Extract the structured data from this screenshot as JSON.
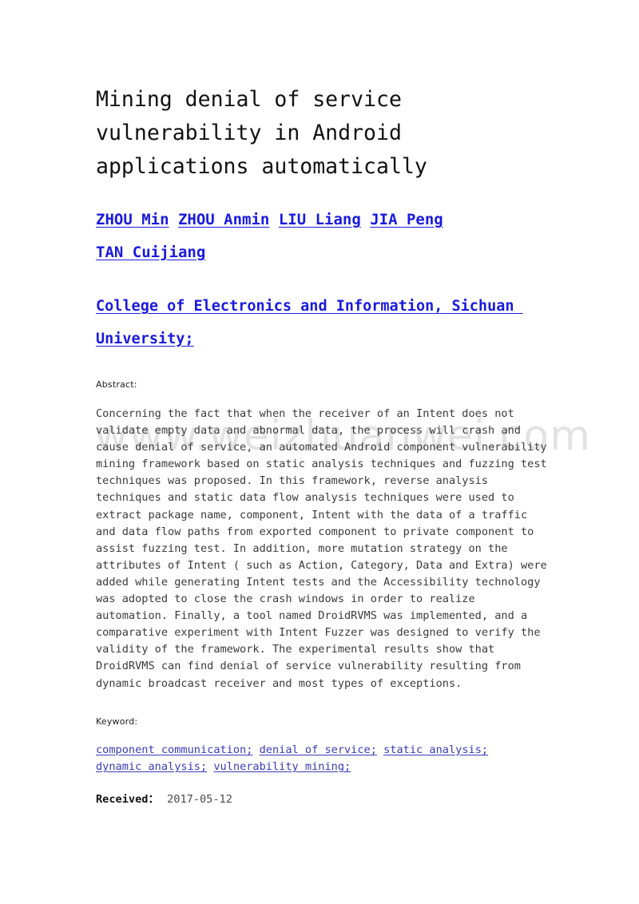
{
  "document": {
    "title": "Mining denial of service vulnerability in Android applications automatically",
    "authors": [
      "ZHOU Min",
      "ZHOU Anmin",
      "LIU Liang",
      "JIA Peng",
      "TAN Cuijiang"
    ],
    "affiliation": "College of Electronics and Information, Sichuan University;",
    "abstract_label": "Abstract:",
    "abstract_text": "Concerning the fact that when the receiver of an Intent does not validate empty data and abnormal data, the process will crash and cause denial of service, an automated Android component vulnerability mining framework based on static analysis techniques and fuzzing test techniques was proposed. In this framework, reverse analysis techniques and static data flow analysis techniques were used to extract package name, component, Intent with the data of a traffic and data flow paths from exported component to private component to assist fuzzing test. In addition, more mutation strategy on the attributes of Intent ( such as Action, Category, Data and Extra) were added while generating Intent tests and the Accessibility technology was adopted to close the crash windows in order to realize automation. Finally, a tool named DroidRVMS was implemented, and a comparative experiment with Intent Fuzzer was designed to verify the validity of the framework. The experimental results show that DroidRVMS can find denial of service vulnerability resulting from dynamic broadcast receiver and most types of exceptions.",
    "keyword_label": "Keyword:",
    "keywords": [
      "component communication;",
      "denial of service;",
      "static analysis;",
      "dynamic analysis;",
      "vulnerability mining;"
    ],
    "received_label": "Received：",
    "received_date": "2017-05-12",
    "watermark": "www.weizhuanwei.com",
    "colors": {
      "link_blue": "#1a1ae0",
      "keyword_blue": "#3a3ab8",
      "body_text": "#3a3a3a",
      "watermark_gray": "#e2e2e2",
      "page_background": "#ffffff"
    }
  }
}
